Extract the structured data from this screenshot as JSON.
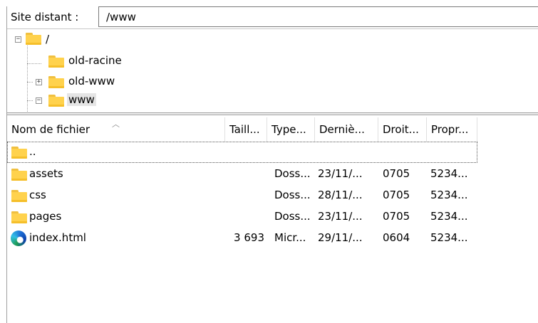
{
  "path_bar": {
    "label": "Site distant :",
    "value": "/www"
  },
  "tree": {
    "root": {
      "label": "/"
    },
    "items": [
      {
        "label": "old-racine"
      },
      {
        "label": "old-www"
      },
      {
        "label": "www"
      }
    ]
  },
  "columns": [
    "Nom de fichier",
    "Taill...",
    "Type...",
    "Derniè...",
    "Droit...",
    "Propr..."
  ],
  "files": [
    {
      "name": "..",
      "size": "",
      "type": "",
      "modified": "",
      "perms": "",
      "owner": ""
    },
    {
      "name": "assets",
      "size": "",
      "type": "Doss...",
      "modified": "23/11/...",
      "perms": "0705",
      "owner": "5234..."
    },
    {
      "name": "css",
      "size": "",
      "type": "Doss...",
      "modified": "28/11/...",
      "perms": "0705",
      "owner": "5234..."
    },
    {
      "name": "pages",
      "size": "",
      "type": "Doss...",
      "modified": "23/11/...",
      "perms": "0705",
      "owner": "5234..."
    },
    {
      "name": "index.html",
      "size": "3 693",
      "type": "Micr...",
      "modified": "29/11/...",
      "perms": "0604",
      "owner": "5234..."
    }
  ],
  "icons": {
    "folder": "folder-icon",
    "html": "edge-browser-icon"
  },
  "colors": {
    "folder": "#ffd24d",
    "selection": "#e5e5e5"
  }
}
